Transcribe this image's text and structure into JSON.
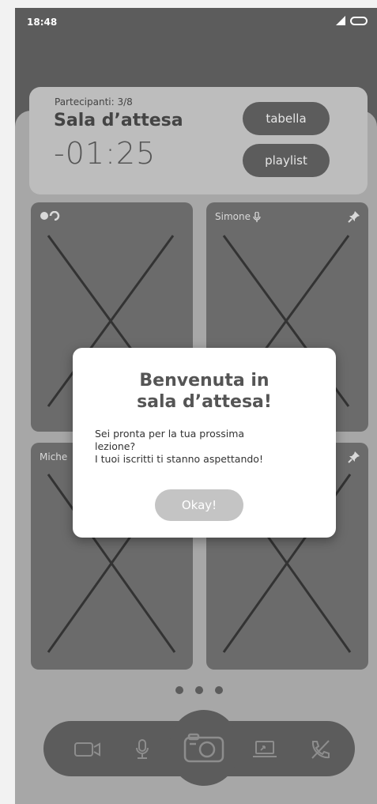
{
  "status_bar": {
    "time": "18:48"
  },
  "room": {
    "participants": "Partecipanti: 3/8",
    "title": "Sala d’attesa",
    "countdown": "-01:25",
    "tabella_label": "tabella",
    "playlist_label": "playlist"
  },
  "tiles": [
    {
      "name": ""
    },
    {
      "name": "Simone"
    },
    {
      "name": "Miche"
    },
    {
      "name": ""
    }
  ],
  "modal": {
    "title": "Benvenuta in\nsala d’attesa!",
    "body_line1": "Sei pronta per la tua prossima",
    "body_line2": "lezione?",
    "body_line3": "I tuoi iscritti ti stanno aspettando!",
    "ok_label": "Okay!"
  },
  "pagination": {
    "pages": 3
  },
  "controls": [
    "video-camera-icon",
    "microphone-icon",
    "camera-icon",
    "screen-share-icon",
    "hang-up-icon"
  ],
  "colors": {
    "dark": "#5c5c5c",
    "tile": "#6b6b6b",
    "sheet": "#a7a7a7",
    "card": "#bdbdbd",
    "overlay_button": "#c4c4c4"
  }
}
